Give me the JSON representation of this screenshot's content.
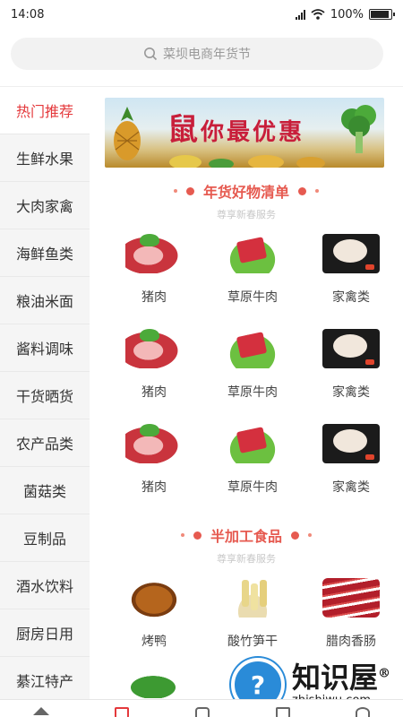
{
  "status_bar": {
    "time": "14:08",
    "battery_text": "100%",
    "battery_level": 1.0
  },
  "search": {
    "placeholder": "菜坝电商年货节"
  },
  "sidebar": {
    "items": [
      {
        "label": "热门推荐",
        "active": true
      },
      {
        "label": "生鲜水果",
        "active": false
      },
      {
        "label": "大肉家禽",
        "active": false
      },
      {
        "label": "海鲜鱼类",
        "active": false
      },
      {
        "label": "粮油米面",
        "active": false
      },
      {
        "label": "酱料调味",
        "active": false
      },
      {
        "label": "干货晒货",
        "active": false
      },
      {
        "label": "农产品类",
        "active": false
      },
      {
        "label": "菌菇类",
        "active": false
      },
      {
        "label": "豆制品",
        "active": false
      },
      {
        "label": "酒水饮料",
        "active": false
      },
      {
        "label": "厨房日用",
        "active": false
      },
      {
        "label": "綦江特产",
        "active": false
      }
    ]
  },
  "banner": {
    "text_big": "鼠",
    "text_rest": "你最优惠"
  },
  "sections": [
    {
      "title": "年货好物清单",
      "subtitle": "尊享新春服务",
      "products": [
        {
          "name": "猪肉",
          "icon": "pork"
        },
        {
          "name": "草原牛肉",
          "icon": "beef"
        },
        {
          "name": "家禽类",
          "icon": "poultry"
        },
        {
          "name": "猪肉",
          "icon": "pork"
        },
        {
          "name": "草原牛肉",
          "icon": "beef"
        },
        {
          "name": "家禽类",
          "icon": "poultry"
        },
        {
          "name": "猪肉",
          "icon": "pork"
        },
        {
          "name": "草原牛肉",
          "icon": "beef"
        },
        {
          "name": "家禽类",
          "icon": "poultry"
        }
      ]
    },
    {
      "title": "半加工食品",
      "subtitle": "尊享新春服务",
      "products": [
        {
          "name": "烤鸭",
          "icon": "duck"
        },
        {
          "name": "酸竹笋干",
          "icon": "bamboo"
        },
        {
          "name": "腊肉香肠",
          "icon": "sausage"
        }
      ]
    }
  ],
  "watermark": {
    "cn": "知识屋",
    "en": "zhishiwu.com",
    "registered": "®"
  },
  "colors": {
    "accent": "#e4393c",
    "section_title": "#e65a50",
    "sidebar_bg": "#f5f5f5"
  }
}
